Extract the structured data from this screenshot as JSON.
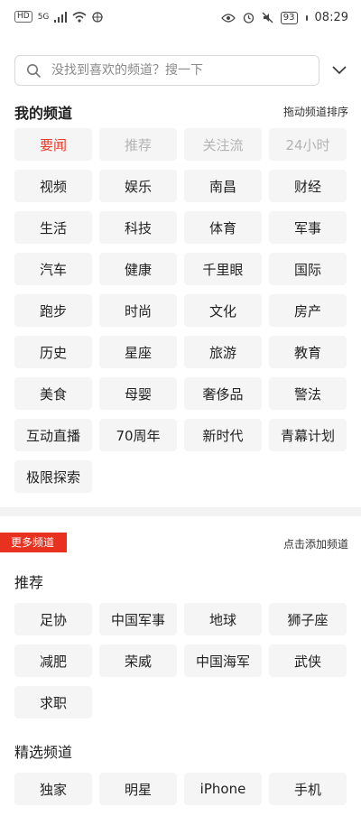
{
  "status_bar": {
    "left_badges": [
      "HD",
      "5G"
    ],
    "battery": "93",
    "time": "08:29"
  },
  "search": {
    "placeholder": "没找到喜欢的频道？搜一下"
  },
  "my_channels": {
    "title": "我的频道",
    "hint": "拖动频道排序",
    "items": [
      {
        "label": "要闻",
        "state": "active"
      },
      {
        "label": "推荐",
        "state": "fixed"
      },
      {
        "label": "关注流",
        "state": "fixed"
      },
      {
        "label": "24小时",
        "state": "fixed"
      },
      {
        "label": "视频"
      },
      {
        "label": "娱乐"
      },
      {
        "label": "南昌"
      },
      {
        "label": "财经"
      },
      {
        "label": "生活"
      },
      {
        "label": "科技"
      },
      {
        "label": "体育"
      },
      {
        "label": "军事"
      },
      {
        "label": "汽车"
      },
      {
        "label": "健康"
      },
      {
        "label": "千里眼"
      },
      {
        "label": "国际"
      },
      {
        "label": "跑步"
      },
      {
        "label": "时尚"
      },
      {
        "label": "文化"
      },
      {
        "label": "房产"
      },
      {
        "label": "历史"
      },
      {
        "label": "星座"
      },
      {
        "label": "旅游"
      },
      {
        "label": "教育"
      },
      {
        "label": "美食"
      },
      {
        "label": "母婴"
      },
      {
        "label": "奢侈品"
      },
      {
        "label": "警法"
      },
      {
        "label": "互动直播"
      },
      {
        "label": "70周年"
      },
      {
        "label": "新时代"
      },
      {
        "label": "青幕计划"
      },
      {
        "label": "极限探索"
      }
    ]
  },
  "more_channels": {
    "badge": "更多频道",
    "hint": "点击添加频道",
    "groups": [
      {
        "title": "推荐",
        "items": [
          "足协",
          "中国军事",
          "地球",
          "狮子座",
          "减肥",
          "荣威",
          "中国海军",
          "武侠",
          "求职"
        ]
      },
      {
        "title": "精选频道",
        "items": [
          "独家",
          "明星",
          "iPhone",
          "手机"
        ]
      }
    ]
  },
  "colors": {
    "accent": "#e83b2c",
    "badge": "#e8321f"
  }
}
